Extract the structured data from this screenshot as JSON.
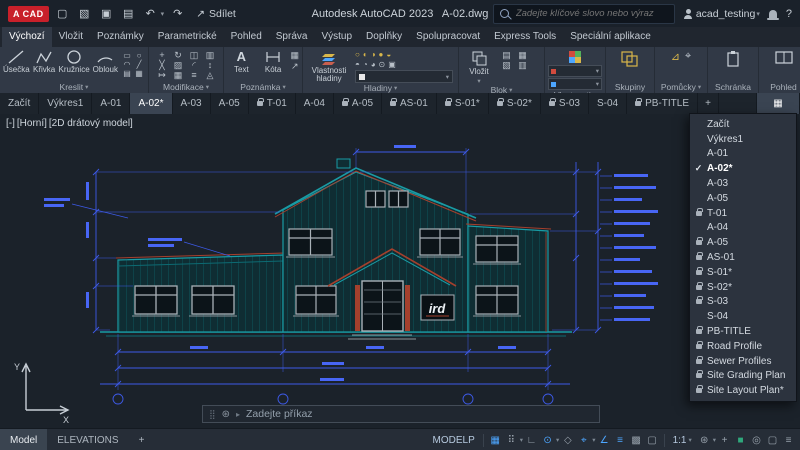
{
  "glyphs": {
    "new": "▢",
    "open": "▧",
    "save": "▣",
    "plot": "▤",
    "undo": "↶",
    "redo": "↷",
    "share": "↗",
    "caret": "▾",
    "caret_right": "▸",
    "check": "✓",
    "help": "?",
    "plus": "+",
    "tab_list": "▦",
    "grip": "⣿",
    "customize": "⊛",
    "text_tool": "A",
    "kreslit_small": [
      "▭",
      "○",
      "◠",
      "╱",
      "▤",
      "▦"
    ],
    "modify": [
      "+",
      "↻",
      "◫",
      "▥",
      "╳",
      "▨",
      "◜",
      "↕",
      "↦",
      "▦",
      "≡",
      "◬"
    ],
    "poznamka_small": [
      "▦",
      "↗"
    ],
    "hladiny_row1": [
      "○",
      "◐",
      "◑",
      "●",
      "◒"
    ],
    "hladiny_row2": [
      "◓",
      "◔",
      "◕",
      "⊙",
      "▣"
    ],
    "blok_small": [
      "▤",
      "▦",
      "▧",
      "▥"
    ],
    "pomucky_icons": [
      "⊿",
      "⌖"
    ]
  },
  "titlebar": {
    "logo": "A CAD",
    "share_label": "Sdílet",
    "title": "Autodesk AutoCAD 2023   A-02.dwg",
    "search_placeholder": "Zadejte klíčové slovo nebo výraz",
    "username": "acad_testing"
  },
  "ribbon_tabs": [
    {
      "label": "Výchozí"
    },
    {
      "label": "Vložit"
    },
    {
      "label": "Poznámky"
    },
    {
      "label": "Parametrické"
    },
    {
      "label": "Pohled"
    },
    {
      "label": "Správa"
    },
    {
      "label": "Výstup"
    },
    {
      "label": "Doplňky"
    },
    {
      "label": "Spolupracovat"
    },
    {
      "label": "Express Tools"
    },
    {
      "label": "Speciální aplikace"
    }
  ],
  "panels": {
    "kreslit": {
      "label": "Kreslit",
      "tools": [
        "Úsečka",
        "Křivka",
        "Kružnice",
        "Oblouk"
      ]
    },
    "modifikace": {
      "label": "Modifikace"
    },
    "poznamka": {
      "label": "Poznámka",
      "text_tool": "Text",
      "dim_tool": "Kóta"
    },
    "hladiny": {
      "label": "Hladiny",
      "big_label": "Vlastnosti hladiny"
    },
    "blok": {
      "label": "Blok",
      "big_label": "Vložit"
    },
    "vlastnosti": {
      "label": "Vlastnosti"
    },
    "skupiny": {
      "label": "Skupiny"
    },
    "pomucky": {
      "label": "Pomůcky"
    },
    "schranka": {
      "label": "Schránka"
    },
    "pohled": {
      "label": "Pohled"
    }
  },
  "file_tabs": [
    {
      "label": "Začít"
    },
    {
      "label": "Výkres1"
    },
    {
      "label": "A-01"
    },
    {
      "label": "A-02*"
    },
    {
      "label": "A-03"
    },
    {
      "label": "A-05"
    },
    {
      "label": "T-01"
    },
    {
      "label": "A-04"
    },
    {
      "label": "A-05"
    },
    {
      "label": "AS-01"
    },
    {
      "label": "S-01*"
    },
    {
      "label": "S-02*"
    },
    {
      "label": "S-03"
    },
    {
      "label": "S-04"
    },
    {
      "label": "PB-TITLE"
    }
  ],
  "tab_menu": [
    {
      "label": "Začít"
    },
    {
      "label": "Výkres1"
    },
    {
      "label": "A-01"
    },
    {
      "label": "A-02*"
    },
    {
      "label": "A-03"
    },
    {
      "label": "A-05"
    },
    {
      "label": "T-01"
    },
    {
      "label": "A-04"
    },
    {
      "label": "A-05"
    },
    {
      "label": "AS-01"
    },
    {
      "label": "S-01*"
    },
    {
      "label": "S-02*"
    },
    {
      "label": "S-03"
    },
    {
      "label": "S-04"
    },
    {
      "label": "PB-TITLE"
    },
    {
      "label": "Road Profile"
    },
    {
      "label": "Sewer Profiles"
    },
    {
      "label": "Site Grading Plan"
    },
    {
      "label": "Site Layout Plan*"
    }
  ],
  "canvas": {
    "viewport_controls": {
      "minimize": "[-]",
      "view": "[Horní]",
      "visual_style": "[2D drátový model]"
    },
    "sign_text": "ird",
    "ucs": {
      "x": "X",
      "y": "Y"
    }
  },
  "command_line": {
    "prompt": "Zadejte příkaz"
  },
  "statusbar": {
    "model_tab": "Model",
    "layout_tab": "ELEVATIONS",
    "add_layout": "+",
    "space_label": "MODELP",
    "scale": "1:1",
    "icons": [
      {
        "name": "grid",
        "glyph": "▦"
      },
      {
        "name": "snap-mode",
        "glyph": "⠿"
      },
      {
        "name": "ortho",
        "glyph": "∟"
      },
      {
        "name": "polar-tracking",
        "glyph": "⊙"
      },
      {
        "name": "isodraft",
        "glyph": "◇"
      },
      {
        "name": "osnap",
        "glyph": "⌖"
      },
      {
        "name": "object-snap-tracking",
        "glyph": "∠"
      },
      {
        "name": "lineweight",
        "glyph": "≡"
      },
      {
        "name": "transparency",
        "glyph": "▩"
      },
      {
        "name": "selection-cycling",
        "glyph": "▢"
      }
    ],
    "trailing": [
      {
        "name": "workspace-switching",
        "glyph": "⊛"
      },
      {
        "name": "annotation-monitor",
        "glyph": "+"
      },
      {
        "name": "hardware-acceleration",
        "glyph": "■"
      },
      {
        "name": "isolate-objects",
        "glyph": "◎"
      },
      {
        "name": "clean-screen",
        "glyph": "▢"
      },
      {
        "name": "customization",
        "glyph": "≡"
      }
    ]
  }
}
